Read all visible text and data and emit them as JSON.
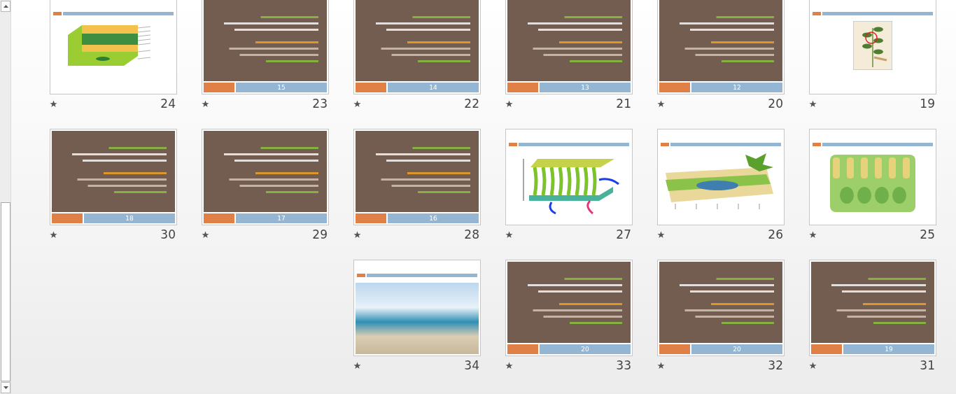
{
  "rows": [
    {
      "slides": [
        {
          "number": "24",
          "kind": "leaf-section"
        },
        {
          "number": "23",
          "kind": "text",
          "footer": "15"
        },
        {
          "number": "22",
          "kind": "text",
          "footer": "14"
        },
        {
          "number": "21",
          "kind": "text",
          "footer": "13"
        },
        {
          "number": "20",
          "kind": "text",
          "footer": "12"
        },
        {
          "number": "19",
          "kind": "plant"
        }
      ]
    },
    {
      "slides": [
        {
          "number": "30",
          "kind": "text",
          "footer": "18"
        },
        {
          "number": "29",
          "kind": "text",
          "footer": "17"
        },
        {
          "number": "28",
          "kind": "text",
          "footer": "16"
        },
        {
          "number": "27",
          "kind": "leaf-3d"
        },
        {
          "number": "26",
          "kind": "leaf-diagram"
        },
        {
          "number": "25",
          "kind": "leaf-block"
        }
      ]
    },
    {
      "slides": [
        {
          "number": "34",
          "kind": "photo"
        },
        {
          "number": "33",
          "kind": "text",
          "footer": "20"
        },
        {
          "number": "32",
          "kind": "text",
          "footer": "20"
        },
        {
          "number": "31",
          "kind": "text",
          "footer": "19"
        }
      ]
    }
  ]
}
